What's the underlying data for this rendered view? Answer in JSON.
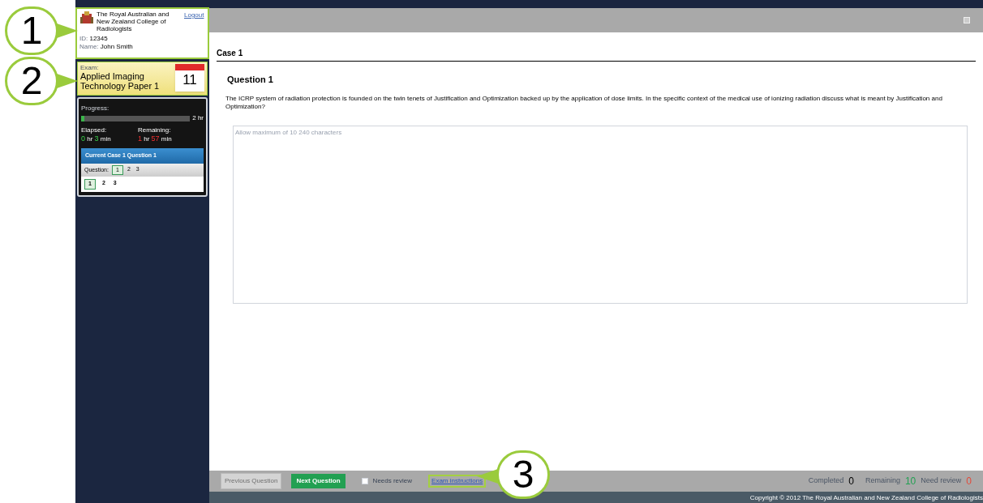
{
  "user_panel": {
    "college_name": "The Royal Australian and New Zealand College of Radiologists",
    "logout": "Logout",
    "id_label": "ID:",
    "id_value": "12345",
    "name_label": "Name:",
    "name_value": "John Smith"
  },
  "exam_panel": {
    "label": "Exam:",
    "title": "Applied Imaging Technology Paper 1",
    "day": "11"
  },
  "progress": {
    "label": "Progress:",
    "level": 0.03,
    "total": "2 hr",
    "elapsed_label": "Elapsed:",
    "elapsed": [
      {
        "value": "0",
        "unit": "hr"
      },
      {
        "value": "3",
        "unit": "min"
      }
    ],
    "remaining_label": "Remaining:",
    "remaining": [
      {
        "value": "1",
        "unit": "hr"
      },
      {
        "value": "57",
        "unit": "min"
      }
    ]
  },
  "current": {
    "title": "Current Case 1 Question 1",
    "question_label": "Question:",
    "questions": [
      {
        "label": "1",
        "selected": true
      },
      {
        "label": "2",
        "selected": false
      },
      {
        "label": "3",
        "selected": false
      }
    ],
    "cases": [
      {
        "label": "1",
        "selected": true
      },
      {
        "label": "2",
        "selected": false
      },
      {
        "label": "3",
        "selected": false
      }
    ]
  },
  "case_title": "Case 1",
  "question_title": "Question 1",
  "question_text": "The ICRP system of radiation protection is founded on the twin tenets of Justification and Optimization backed up by the application of dose limits. In the specific context of the medical use of ionizing radiation discuss what is meant by Justification and Optimization?",
  "answer": {
    "placeholder": "Allow maximum of 10 240 characters"
  },
  "bottom_bar": {
    "previous": "Previous Question",
    "previous_disabled": true,
    "next": "Next Question",
    "needs_review": {
      "label": "Needs review",
      "checked": false
    },
    "instructions": "Exam instructions",
    "completed_label": "Completed",
    "completed": "0",
    "remaining_label": "Remaining",
    "remaining": "10",
    "review_label": "Need review",
    "review": "0"
  },
  "footer": "Copyright © 2012 The Royal Australian and New Zealand College of Radiologists",
  "callouts": [
    "1",
    "2",
    "3"
  ]
}
